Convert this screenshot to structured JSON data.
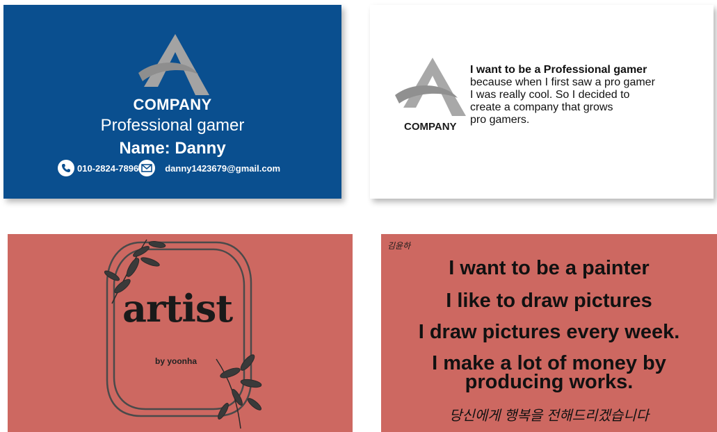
{
  "cards": {
    "blue": {
      "company": "COMPANY",
      "role": "Professional gamer",
      "name": "Name: Danny",
      "phone": "010-2824-7896",
      "email": "danny1423679@gmail.com",
      "colors": {
        "background": "#0a4f8f",
        "logo": "#9a9a9a"
      },
      "icons": [
        "logo-icon",
        "phone-icon",
        "mail-icon"
      ]
    },
    "white": {
      "company": "COMPANY",
      "heading": "I want to be a Professional gamer",
      "lines": [
        "because when I first saw a pro gamer",
        "I was really cool. So I decided to",
        "create a company that grows",
        "pro gamers."
      ],
      "colors": {
        "background": "#ffffff"
      },
      "icons": [
        "logo-icon"
      ]
    },
    "artist": {
      "title": "artist",
      "byline": "by yoonha",
      "colors": {
        "background": "#cd6861"
      },
      "icons": [
        "leaf-branch-icon",
        "oval-frame-icon"
      ]
    },
    "painter": {
      "signature": "김윤하",
      "lines": [
        "I want to be a painter",
        "I like to draw pictures",
        "I draw pictures every week.",
        "I make a lot of money by",
        "producing works."
      ],
      "footer": "당신에게 행복을 전해드리겠습니다",
      "colors": {
        "background": "#cd6861"
      }
    }
  }
}
